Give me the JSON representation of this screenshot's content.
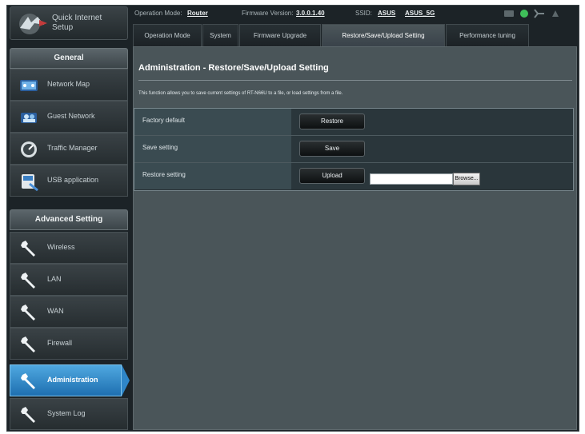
{
  "quick_setup": {
    "label": "Quick Internet Setup"
  },
  "status_bar": {
    "operation_mode_label": "Operation Mode:",
    "operation_mode_value": "Router",
    "firmware_label": "Firmware Version:",
    "firmware_value": "3.0.0.1.40",
    "ssid_label": "SSID:",
    "ssid_1": "ASUS",
    "ssid_2": "ASUS_5G"
  },
  "tabs": [
    {
      "label": "Operation Mode"
    },
    {
      "label": "System"
    },
    {
      "label": "Firmware Upgrade"
    },
    {
      "label": "Restore/Save/Upload Setting",
      "active": true
    },
    {
      "label": "Performance tuning"
    }
  ],
  "sidebar": {
    "general_header": "General",
    "general_items": [
      {
        "label": "Network Map",
        "icon": "network-map-icon"
      },
      {
        "label": "Guest Network",
        "icon": "guest-network-icon"
      },
      {
        "label": "Traffic Manager",
        "icon": "traffic-manager-icon"
      },
      {
        "label": "USB application",
        "icon": "usb-application-icon"
      }
    ],
    "advanced_header": "Advanced Setting",
    "advanced_items": [
      {
        "label": "Wireless",
        "icon": "wrench-icon"
      },
      {
        "label": "LAN",
        "icon": "wrench-icon"
      },
      {
        "label": "WAN",
        "icon": "wrench-icon"
      },
      {
        "label": "Firewall",
        "icon": "wrench-icon"
      },
      {
        "label": "Administration",
        "icon": "wrench-icon",
        "active": true
      },
      {
        "label": "System Log",
        "icon": "wrench-icon"
      }
    ]
  },
  "main": {
    "title": "Administration - Restore/Save/Upload Setting",
    "description": "This function allows you to save current settings of RT-N66U to a file, or load settings from a file.",
    "rows": [
      {
        "label": "Factory default",
        "button": "Restore"
      },
      {
        "label": "Save setting",
        "button": "Save"
      },
      {
        "label": "Restore setting",
        "button": "Upload",
        "browse": "Browse..."
      }
    ]
  },
  "colors": {
    "accent": "#2f86c8",
    "background": "#1c2327",
    "panel": "#4a5559"
  }
}
